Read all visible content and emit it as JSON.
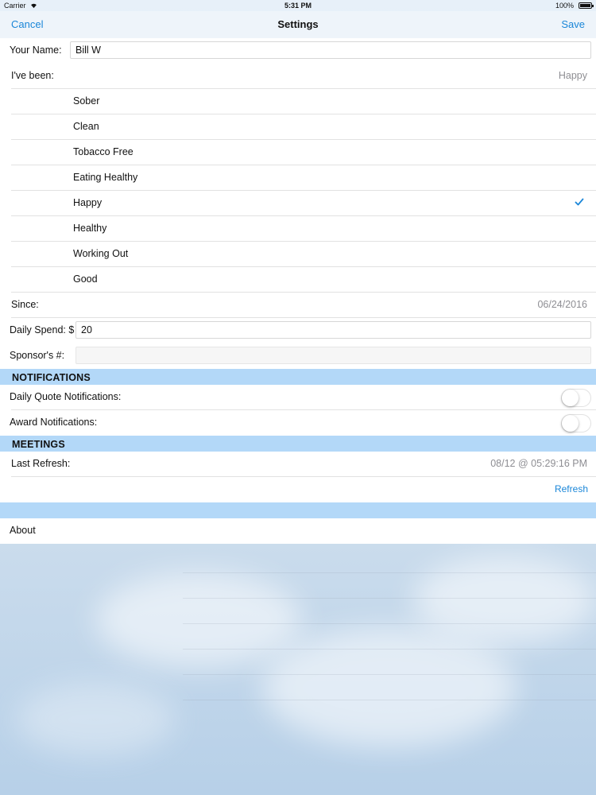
{
  "status_bar": {
    "carrier": "Carrier",
    "time": "5:31 PM",
    "battery": "100%"
  },
  "nav": {
    "cancel": "Cancel",
    "title": "Settings",
    "save": "Save"
  },
  "name_field": {
    "label": "Your Name:",
    "value": "Bill W"
  },
  "been": {
    "label": "I've been:",
    "selected": "Happy",
    "options": [
      "Sober",
      "Clean",
      "Tobacco Free",
      "Eating Healthy",
      "Happy",
      "Healthy",
      "Working Out",
      "Good"
    ]
  },
  "since": {
    "label": "Since:",
    "value": "06/24/2016"
  },
  "daily_spend": {
    "label": "Daily Spend: $",
    "value": "20"
  },
  "sponsor": {
    "label": "Sponsor's #:",
    "value": ""
  },
  "notifications": {
    "header": "NOTIFICATIONS",
    "daily_quote": "Daily Quote Notifications:",
    "award": "Award Notifications:",
    "daily_quote_on": false,
    "award_on": false
  },
  "meetings": {
    "header": "MEETINGS",
    "last_refresh_label": "Last Refresh:",
    "last_refresh_value": "08/12 @ 05:29:16 PM",
    "refresh": "Refresh"
  },
  "about": "About",
  "colors": {
    "accent": "#1a86d8",
    "section": "#b3d8f8"
  }
}
